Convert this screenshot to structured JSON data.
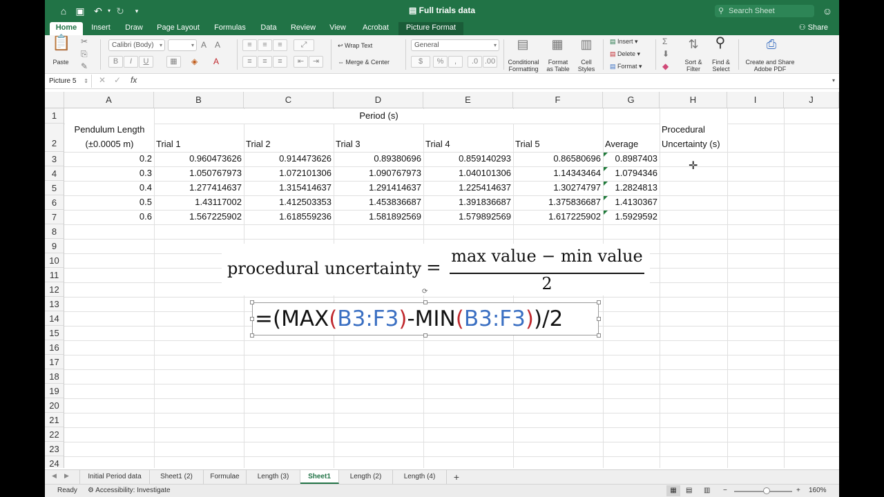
{
  "window": {
    "title": "Full trials data"
  },
  "search": {
    "placeholder": "Search Sheet"
  },
  "tabs": [
    "Home",
    "Insert",
    "Draw",
    "Page Layout",
    "Formulas",
    "Data",
    "Review",
    "View",
    "Acrobat",
    "Picture Format"
  ],
  "share_label": "Share",
  "ribbon": {
    "paste": "Paste",
    "font_name": "Calibri (Body)",
    "wrap_text": "Wrap Text",
    "merge_center": "Merge & Center",
    "number_format": "General",
    "conditional_formatting": [
      "Conditional",
      "Formatting"
    ],
    "format_as_table": [
      "Format",
      "as Table"
    ],
    "cell_styles": [
      "Cell",
      "Styles"
    ],
    "insert": "Insert",
    "delete": "Delete",
    "format": "Format",
    "sort_filter": [
      "Sort &",
      "Filter"
    ],
    "find_select": [
      "Find &",
      "Select"
    ],
    "create_share_pdf": [
      "Create and Share",
      "Adobe PDF"
    ]
  },
  "name_box": "Picture 5",
  "columns": [
    "A",
    "B",
    "C",
    "D",
    "E",
    "F",
    "G",
    "H",
    "I",
    "J"
  ],
  "rows": [
    "1",
    "2",
    "3",
    "4",
    "5",
    "6",
    "7",
    "8",
    "9",
    "10",
    "11",
    "12",
    "13",
    "14",
    "15",
    "16",
    "17",
    "18",
    "19",
    "20",
    "21",
    "22",
    "23",
    "24"
  ],
  "sheet": {
    "period_header": "Period (s)",
    "pendulum_header": [
      "Pendulum Length",
      "(±0.0005 m)"
    ],
    "trial_headers": [
      "Trial 1",
      "Trial 2",
      "Trial 3",
      "Trial 4",
      "Trial 5"
    ],
    "average_header": "Average",
    "procedural_header": [
      "Procedural",
      "Uncertainty (s)"
    ],
    "data": [
      [
        "0.2",
        "0.960473626",
        "0.914473626",
        "0.89380696",
        "0.859140293",
        "0.86580696",
        "0.8987403"
      ],
      [
        "0.3",
        "1.050767973",
        "1.072101306",
        "1.090767973",
        "1.040101306",
        "1.14343464",
        "1.0794346"
      ],
      [
        "0.4",
        "1.277414637",
        "1.315414637",
        "1.291414637",
        "1.225414637",
        "1.30274797",
        "1.2824813"
      ],
      [
        "0.5",
        "1.43117002",
        "1.412503353",
        "1.453836687",
        "1.391836687",
        "1.375836687",
        "1.4130367"
      ],
      [
        "0.6",
        "1.567225902",
        "1.618559236",
        "1.581892569",
        "1.579892569",
        "1.617225902",
        "1.5929592"
      ]
    ]
  },
  "equation": {
    "lhs": "procedural uncertainty",
    "equals": "=",
    "numerator": "max value − min value",
    "denominator": "2"
  },
  "formula_image": {
    "part1": "=(MAX",
    "paren_open": "(",
    "range1": "B3:F3",
    "paren_close": ")",
    "part2": "-MIN",
    "paren_open2": "(",
    "range2": "B3:F3",
    "paren_close2": ")",
    "part3": ")/2"
  },
  "sheet_tabs": [
    "Initial Period data",
    "Sheet1 (2)",
    "Formulae",
    "Length (3)",
    "Sheet1",
    "Length (2)",
    "Length (4)"
  ],
  "active_sheet": "Sheet1",
  "status": {
    "ready": "Ready",
    "accessibility": "Accessibility: Investigate",
    "zoom": "160%"
  },
  "colors": {
    "excel_green": "#217346",
    "formula_red": "#c0282d",
    "formula_blue": "#3a6fc2"
  }
}
